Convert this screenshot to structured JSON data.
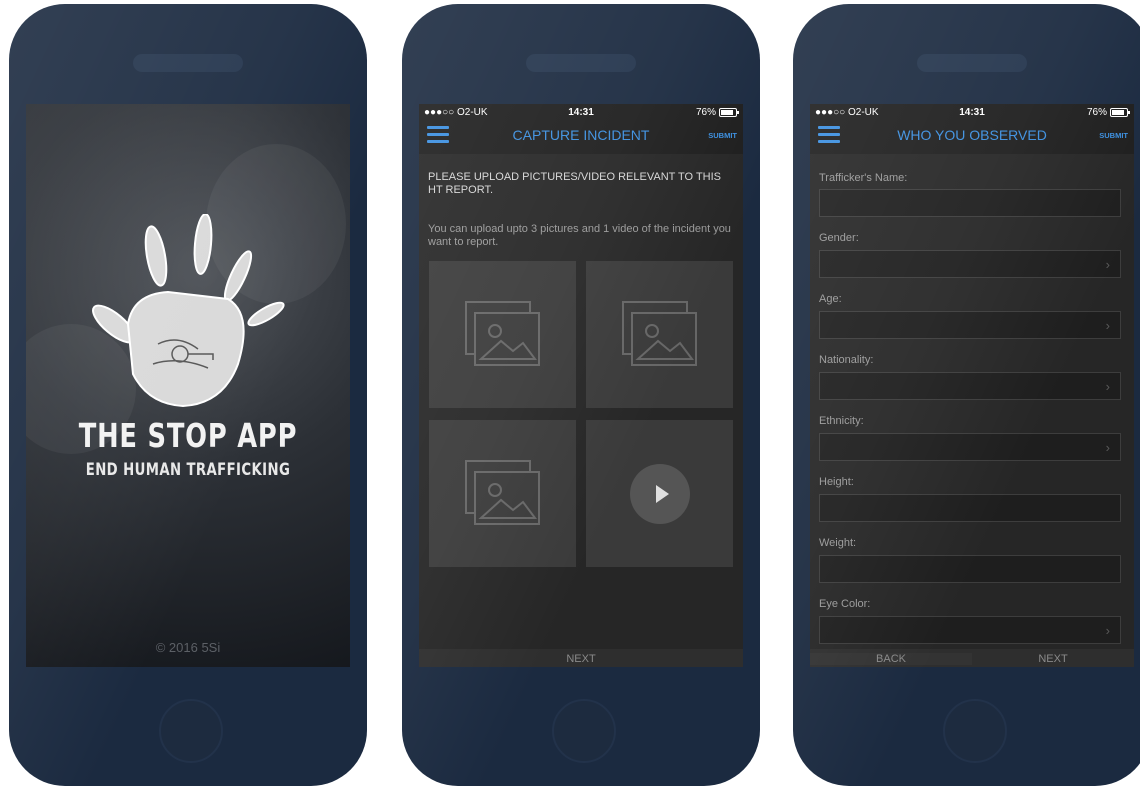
{
  "splash": {
    "app_title": "THE STOP APP",
    "app_subtitle": "END HUMAN TRAFFICKING",
    "copyright": "© 2016 5Si",
    "logo_icon": "handprint-icon"
  },
  "status_bar": {
    "carrier": "●●●○○ O2-UK",
    "time": "14:31",
    "battery": "76%"
  },
  "capture": {
    "title": "CAPTURE INCIDENT",
    "submit": "SUBMIT",
    "instruction": "PLEASE UPLOAD PICTURES/VIDEO RELEVANT TO THIS HT REPORT.",
    "sub_instruction": "You can upload upto 3 pictures and 1 video of the incident you want to report.",
    "tiles": [
      "image-upload-icon",
      "image-upload-icon",
      "image-upload-icon",
      "video-play-icon"
    ],
    "next": "NEXT"
  },
  "observed": {
    "title": "WHO YOU OBSERVED",
    "submit": "SUBMIT",
    "fields": [
      {
        "label": "Trafficker's Name:",
        "type": "text"
      },
      {
        "label": "Gender:",
        "type": "select"
      },
      {
        "label": "Age:",
        "type": "select"
      },
      {
        "label": "Nationality:",
        "type": "select"
      },
      {
        "label": "Ethnicity:",
        "type": "select"
      },
      {
        "label": "Height:",
        "type": "text"
      },
      {
        "label": "Weight:",
        "type": "text"
      },
      {
        "label": "Eye Color:",
        "type": "select"
      }
    ],
    "back": "BACK",
    "next": "NEXT"
  },
  "colors": {
    "accent": "#3b8fe0",
    "phone_body": "#1b2a40"
  }
}
